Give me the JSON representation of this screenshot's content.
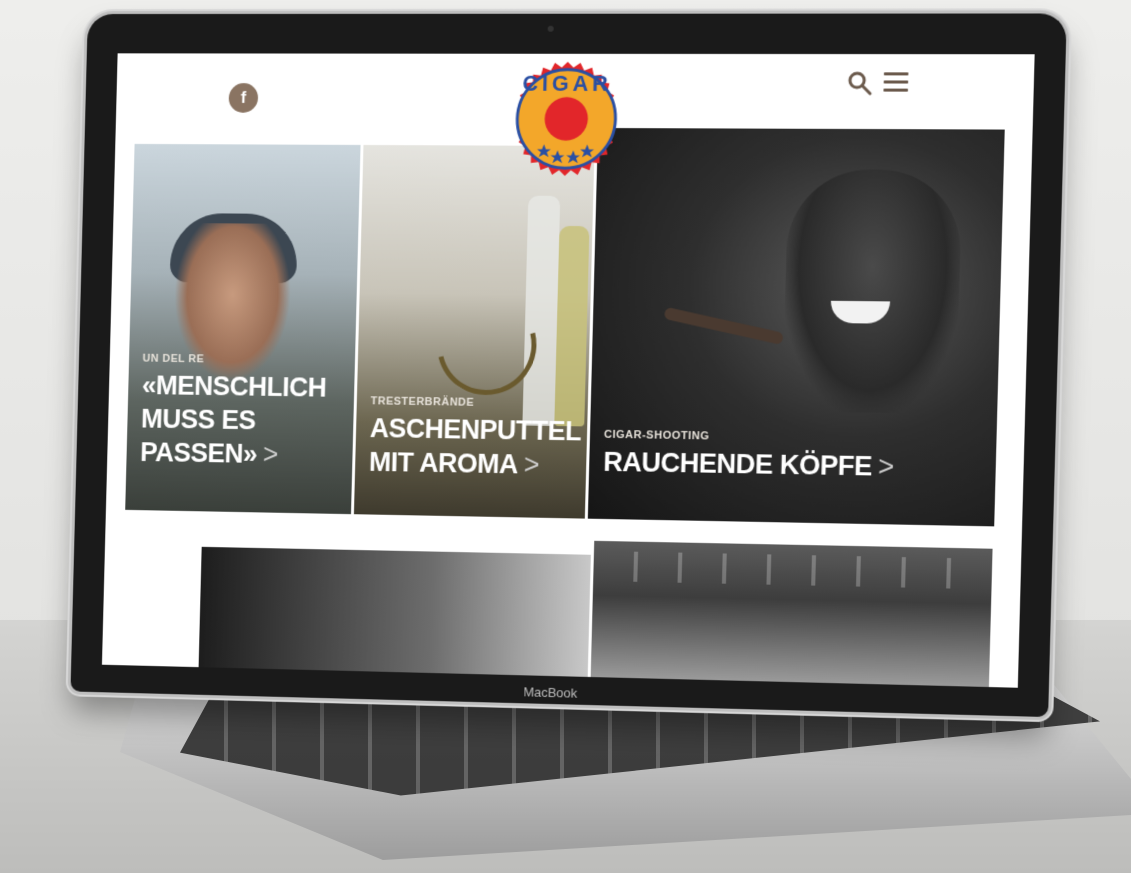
{
  "device": {
    "brand_label": "MacBook"
  },
  "header": {
    "facebook_label": "f",
    "search_icon": "search-icon",
    "menu_icon": "hamburger-menu-icon",
    "logo_text": "CIGAR"
  },
  "tiles": [
    {
      "kicker": "UN DEL RE",
      "headline": "«MENSCHLICH MUSS ES PASSEN»",
      "chevron": ">"
    },
    {
      "kicker": "TRESTERBRÄNDE",
      "headline": "ASCHENPUTTEL MIT AROMA",
      "chevron": ">"
    },
    {
      "kicker": "CIGAR-SHOOTING",
      "headline": "RAUCHENDE KÖPFE",
      "chevron": ">"
    }
  ],
  "colors": {
    "brand_brown": "#8a7462",
    "logo_orange": "#f3a72a",
    "logo_blue": "#2a4fa3",
    "logo_red": "#e2262a"
  }
}
